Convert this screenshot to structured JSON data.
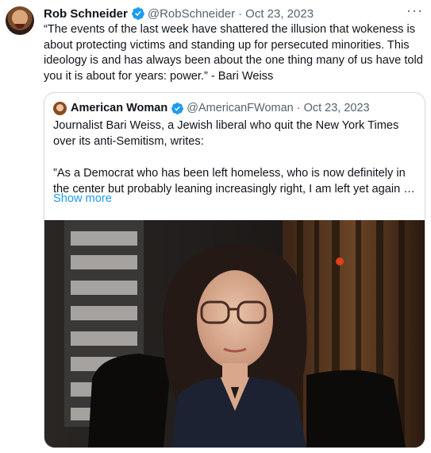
{
  "tweet": {
    "author_name": "Rob Schneider",
    "handle": "@RobSchneider",
    "separator": "·",
    "date": "Oct 23, 2023",
    "more_label": "···",
    "text": "“The events of the last week have shattered the illusion that wokeness is about protecting victims and standing up for persecuted minorities. This ideology is and has always been about the one thing many of us have told you it is about for years: power.” - Bari Weiss",
    "verified_color": "#1d9bf0"
  },
  "quote": {
    "author_name": "American Woman",
    "handle": "@AmericanFWoman",
    "separator": "·",
    "date": "Oct 23, 2023",
    "text": "Journalist Bari Weiss, a Jewish liberal who quit the New York Times over its anti-Semitism, writes:\n\n”As a Democrat who has been left homeless, who is now definitely in the center but probably leaning increasingly right, I am left yet again …",
    "show_more": "Show more",
    "link_color": "#1d9bf0"
  }
}
